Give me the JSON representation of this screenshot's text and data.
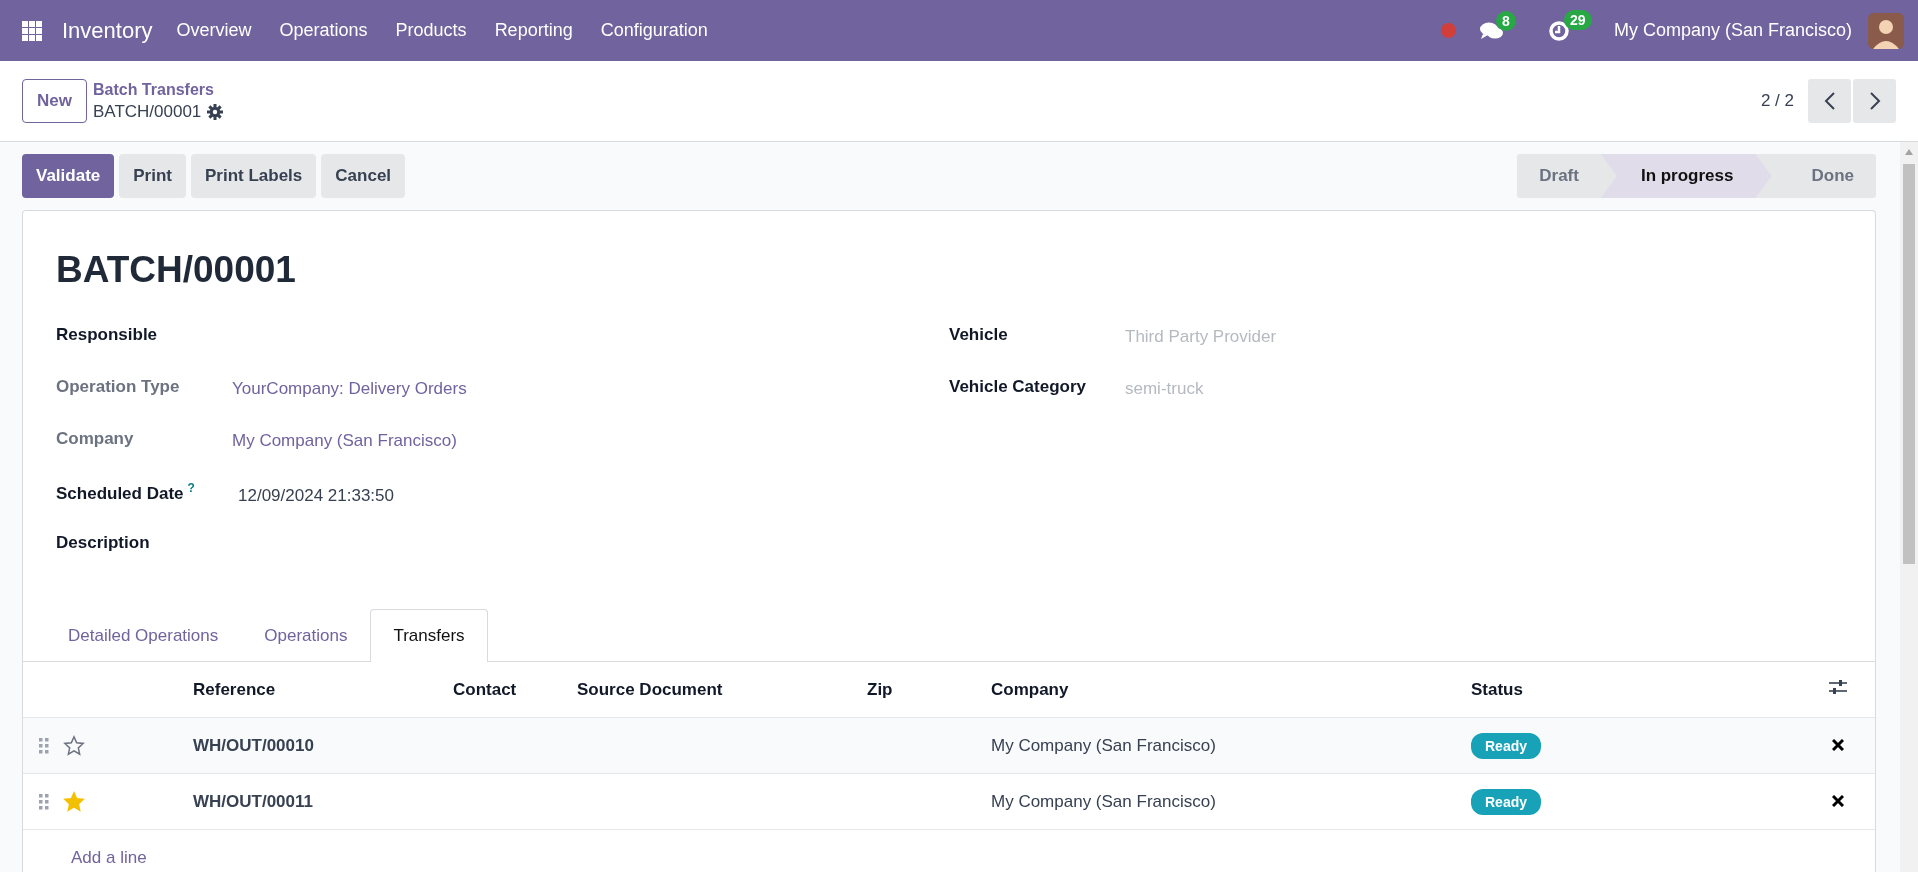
{
  "navbar": {
    "app_name": "Inventory",
    "menu": [
      "Overview",
      "Operations",
      "Products",
      "Reporting",
      "Configuration"
    ],
    "messages_count": "8",
    "activities_count": "29",
    "company": "My Company (San Francisco)"
  },
  "control_panel": {
    "new_button": "New",
    "breadcrumb": "Batch Transfers",
    "record_name": "BATCH/00001",
    "pager": "2 / 2"
  },
  "actions": [
    {
      "label": "Validate",
      "primary": true
    },
    {
      "label": "Print",
      "primary": false
    },
    {
      "label": "Print Labels",
      "primary": false
    },
    {
      "label": "Cancel",
      "primary": false
    }
  ],
  "statusbar": [
    {
      "label": "Draft",
      "selected": false
    },
    {
      "label": "In progress",
      "selected": true
    },
    {
      "label": "Done",
      "selected": false
    }
  ],
  "form": {
    "title": "BATCH/00001",
    "left_fields": [
      {
        "label": "Responsible",
        "readonly": false,
        "kind": "empty"
      },
      {
        "label": "Operation Type",
        "readonly": true,
        "kind": "link",
        "value": "YourCompany: Delivery Orders"
      },
      {
        "label": "Company",
        "readonly": true,
        "kind": "link",
        "value": "My Company (San Francisco)"
      },
      {
        "label": "Scheduled Date",
        "help": "?",
        "readonly": false,
        "kind": "text",
        "value": "12/09/2024 21:33:50"
      },
      {
        "label": "Description",
        "readonly": false,
        "kind": "empty"
      }
    ],
    "right_fields": [
      {
        "label": "Vehicle",
        "readonly": false,
        "kind": "placeholder",
        "placeholder": "Third Party Provider"
      },
      {
        "label": "Vehicle Category",
        "readonly": false,
        "kind": "placeholder",
        "placeholder": "semi-truck"
      }
    ]
  },
  "tabs": [
    {
      "label": "Detailed Operations",
      "selected": false
    },
    {
      "label": "Operations",
      "selected": false
    },
    {
      "label": "Transfers",
      "selected": true
    }
  ],
  "table": {
    "columns": [
      "Reference",
      "Contact",
      "Source Document",
      "Zip",
      "Company",
      "Status"
    ],
    "rows": [
      {
        "favorite": false,
        "reference": "WH/OUT/00010",
        "company": "My Company (San Francisco)",
        "status": "Ready"
      },
      {
        "favorite": true,
        "reference": "WH/OUT/00011",
        "company": "My Company (San Francisco)",
        "status": "Ready"
      }
    ],
    "add_line": "Add a line"
  }
}
